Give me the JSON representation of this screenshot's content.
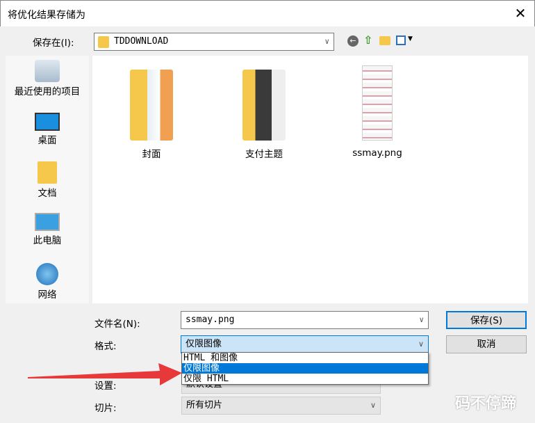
{
  "window": {
    "title": "将优化结果存储为",
    "close": "✕"
  },
  "save_in": {
    "label": "保存在(I):",
    "value": "TDDOWNLOAD"
  },
  "toolbar": {
    "icons": [
      "back-icon",
      "up-folder-icon",
      "new-folder-icon",
      "view-menu-icon"
    ]
  },
  "sidebar": {
    "items": [
      {
        "label": "最近使用的项目"
      },
      {
        "label": "桌面"
      },
      {
        "label": "文档"
      },
      {
        "label": "此电脑"
      },
      {
        "label": "网络"
      }
    ]
  },
  "files": [
    {
      "name": "封面"
    },
    {
      "name": "支付主题"
    },
    {
      "name": "ssmay.png"
    }
  ],
  "filename": {
    "label": "文件名(N):",
    "value": "ssmay.png"
  },
  "format": {
    "label": "格式:",
    "value": "仅限图像",
    "options": [
      "HTML 和图像",
      "仅限图像",
      "仅限 HTML"
    ]
  },
  "settings": {
    "label": "设置:",
    "value": "默认设置"
  },
  "slices": {
    "label": "切片:",
    "value": "所有切片"
  },
  "buttons": {
    "save": "保存(S)",
    "cancel": "取消"
  },
  "watermark": "码不停蹄",
  "colors": {
    "accent": "#0078d7",
    "arrow": "#e8393a"
  }
}
